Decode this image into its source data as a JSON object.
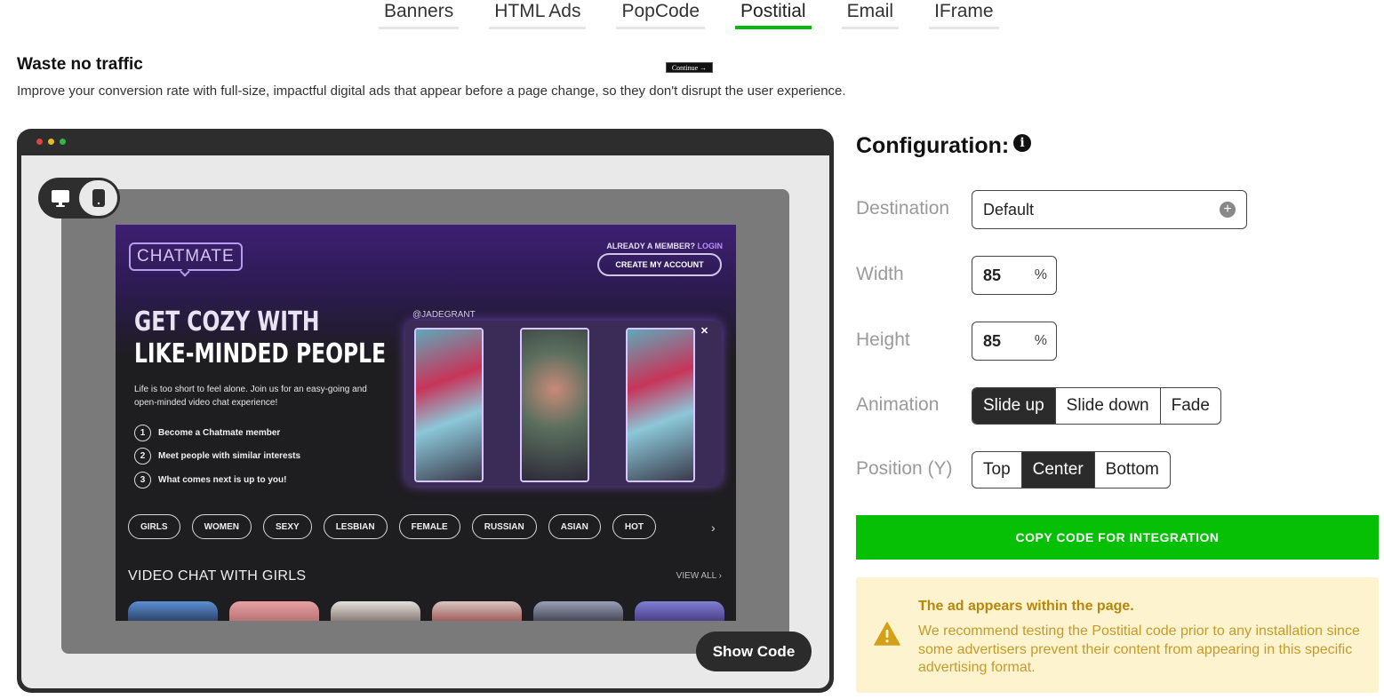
{
  "tabs": [
    {
      "label": "Banners",
      "active": false
    },
    {
      "label": "HTML Ads",
      "active": false
    },
    {
      "label": "PopCode",
      "active": false
    },
    {
      "label": "Postitial",
      "active": true
    },
    {
      "label": "Email",
      "active": false
    },
    {
      "label": "IFrame",
      "active": false
    }
  ],
  "hero": {
    "title": "Waste no traffic",
    "subtitle": "Improve your conversion rate with full-size, impactful digital ads that appear before a page change, so they don't disrupt the user experience."
  },
  "preview": {
    "continue_label": "Continue",
    "show_code_label": "Show Code",
    "ad": {
      "logo": "CHATMATE",
      "member_text": "ALREADY A MEMBER?",
      "login_text": "LOGIN",
      "create_account": "CREATE MY ACCOUNT",
      "headline_line1": "GET COZY WITH",
      "headline_line2": "LIKE-MINDED PEOPLE",
      "description": "Life is too short to feel alone. Join us for an easy-going and open-minded video chat experience!",
      "steps": [
        {
          "num": "1",
          "text": "Become a Chatmate member"
        },
        {
          "num": "2",
          "text": "Meet people with similar interests"
        },
        {
          "num": "3",
          "text": "What comes next is up to you!"
        }
      ],
      "handle": "@JADEGRANT",
      "tags": [
        "GIRLS",
        "WOMEN",
        "SEXY",
        "LESBIAN",
        "FEMALE",
        "RUSSIAN",
        "ASIAN",
        "HOT"
      ],
      "section_title": "VIDEO CHAT WITH GIRLS",
      "view_all": "VIEW ALL"
    }
  },
  "config": {
    "title": "Configuration:",
    "destination": {
      "label": "Destination",
      "value": "Default"
    },
    "width": {
      "label": "Width",
      "value": "85",
      "unit": "%"
    },
    "height": {
      "label": "Height",
      "value": "85",
      "unit": "%"
    },
    "animation": {
      "label": "Animation",
      "options": [
        "Slide up",
        "Slide down",
        "Fade"
      ],
      "selected": "Slide up"
    },
    "position": {
      "label": "Position (Y)",
      "options": [
        "Top",
        "Center",
        "Bottom"
      ],
      "selected": "Center"
    },
    "copy_button": "COPY CODE FOR INTEGRATION",
    "notice": {
      "title": "The ad appears within the page.",
      "text": "We recommend testing the Postitial code prior to any installation since some advertisers prevent their content from appearing in this specific advertising format."
    }
  },
  "colors": {
    "accent_green": "#06c006",
    "dark": "#2b2b2b",
    "notice_bg": "#fdf4cf",
    "notice_text": "#c49a2c"
  }
}
